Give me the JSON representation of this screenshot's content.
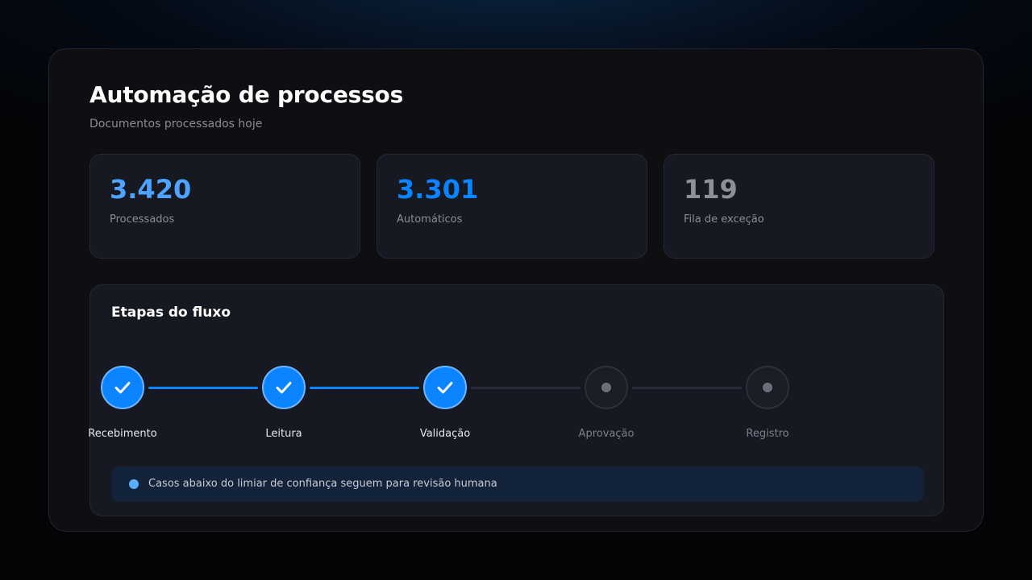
{
  "header": {
    "title": "Automação de processos",
    "subtitle": "Documentos processados hoje"
  },
  "stats": [
    {
      "value": "3.420",
      "label": "Processados",
      "color": "#4da3ff"
    },
    {
      "value": "3.301",
      "label": "Automáticos",
      "color": "#0a84ff"
    },
    {
      "value": "119",
      "label": "Fila de exceção",
      "color": "#8e9099"
    }
  ],
  "flow": {
    "title": "Etapas do fluxo",
    "steps": [
      {
        "label": "Recebimento",
        "status": "done",
        "icon": "check-icon"
      },
      {
        "label": "Leitura",
        "status": "done",
        "icon": "check-icon"
      },
      {
        "label": "Validação",
        "status": "done",
        "icon": "check-icon"
      },
      {
        "label": "Aprovação",
        "status": "pending",
        "icon": "dot-icon"
      },
      {
        "label": "Registro",
        "status": "pending",
        "icon": "dot-icon"
      }
    ],
    "notice": "Casos abaixo do limiar de confiança seguem para revisão humana"
  },
  "colors": {
    "accent": "#0a84ff",
    "accent_light": "#4da3ff",
    "muted": "#8e9099",
    "connector_done": "#0a84ff",
    "connector_pending": "#272a34"
  }
}
